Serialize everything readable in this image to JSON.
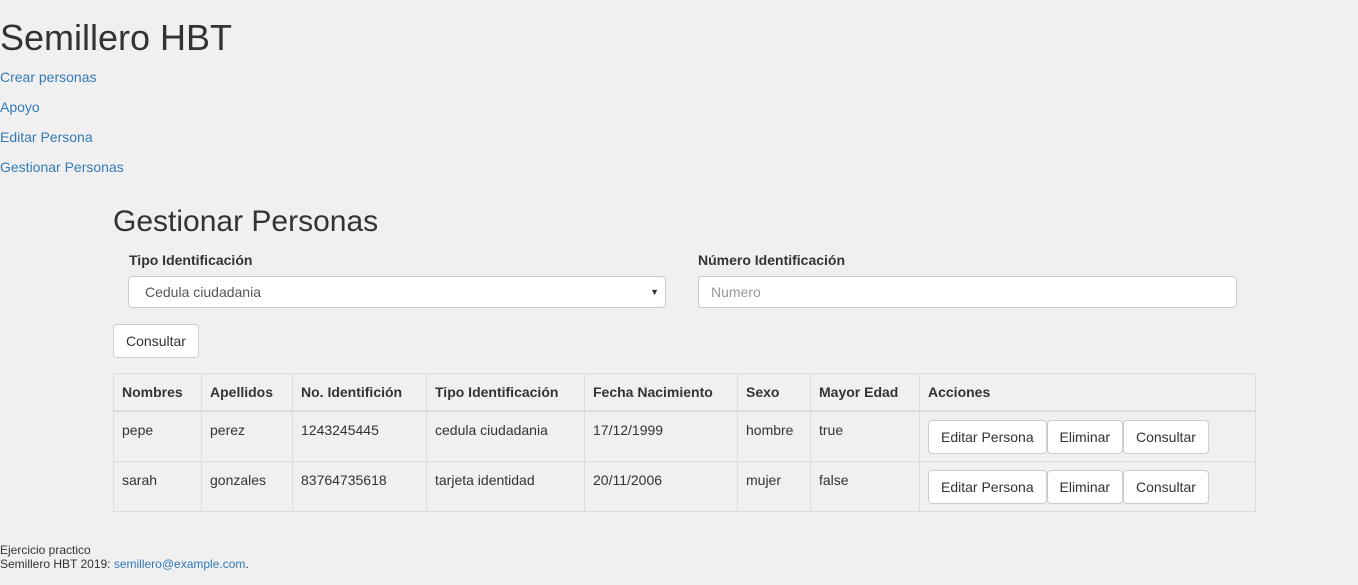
{
  "header": {
    "title": "Semillero HBT"
  },
  "nav": {
    "items": [
      {
        "label": "Crear personas"
      },
      {
        "label": "Apoyo"
      },
      {
        "label": "Editar Persona"
      },
      {
        "label": "Gestionar Personas"
      }
    ]
  },
  "main": {
    "title": "Gestionar Personas",
    "form": {
      "tipo_label": "Tipo Identificación",
      "tipo_value": "Cedula ciudadania",
      "numero_label": "Número Identificación",
      "numero_value": "",
      "numero_placeholder": "Numero",
      "consultar_label": "Consultar"
    },
    "table": {
      "headers": [
        "Nombres",
        "Apellidos",
        "No. Identifición",
        "Tipo Identificación",
        "Fecha Nacimiento",
        "Sexo",
        "Mayor Edad",
        "Acciones"
      ],
      "rows": [
        {
          "nombres": "pepe",
          "apellidos": "perez",
          "numero": "1243245445",
          "tipo": "cedula ciudadania",
          "fecha": "17/12/1999",
          "sexo": "hombre",
          "mayor_edad": "true",
          "actions": [
            "Editar Persona",
            "Eliminar",
            "Consultar"
          ]
        },
        {
          "nombres": "sarah",
          "apellidos": "gonzales",
          "numero": "83764735618",
          "tipo": "tarjeta identidad",
          "fecha": "20/11/2006",
          "sexo": "mujer",
          "mayor_edad": "false",
          "actions": [
            "Editar Persona",
            "Eliminar",
            "Consultar"
          ]
        }
      ]
    }
  },
  "footer": {
    "line1": "Ejercicio practico",
    "line2_prefix": "Semillero HBT 2019: ",
    "email": "semillero@example.com",
    "line2_suffix": "."
  },
  "colors": {
    "background": "#f0f0f0",
    "link": "#337ab7",
    "text": "#333333",
    "border": "#dddddd"
  },
  "icons": {
    "select_arrow": "caret-down-icon"
  }
}
